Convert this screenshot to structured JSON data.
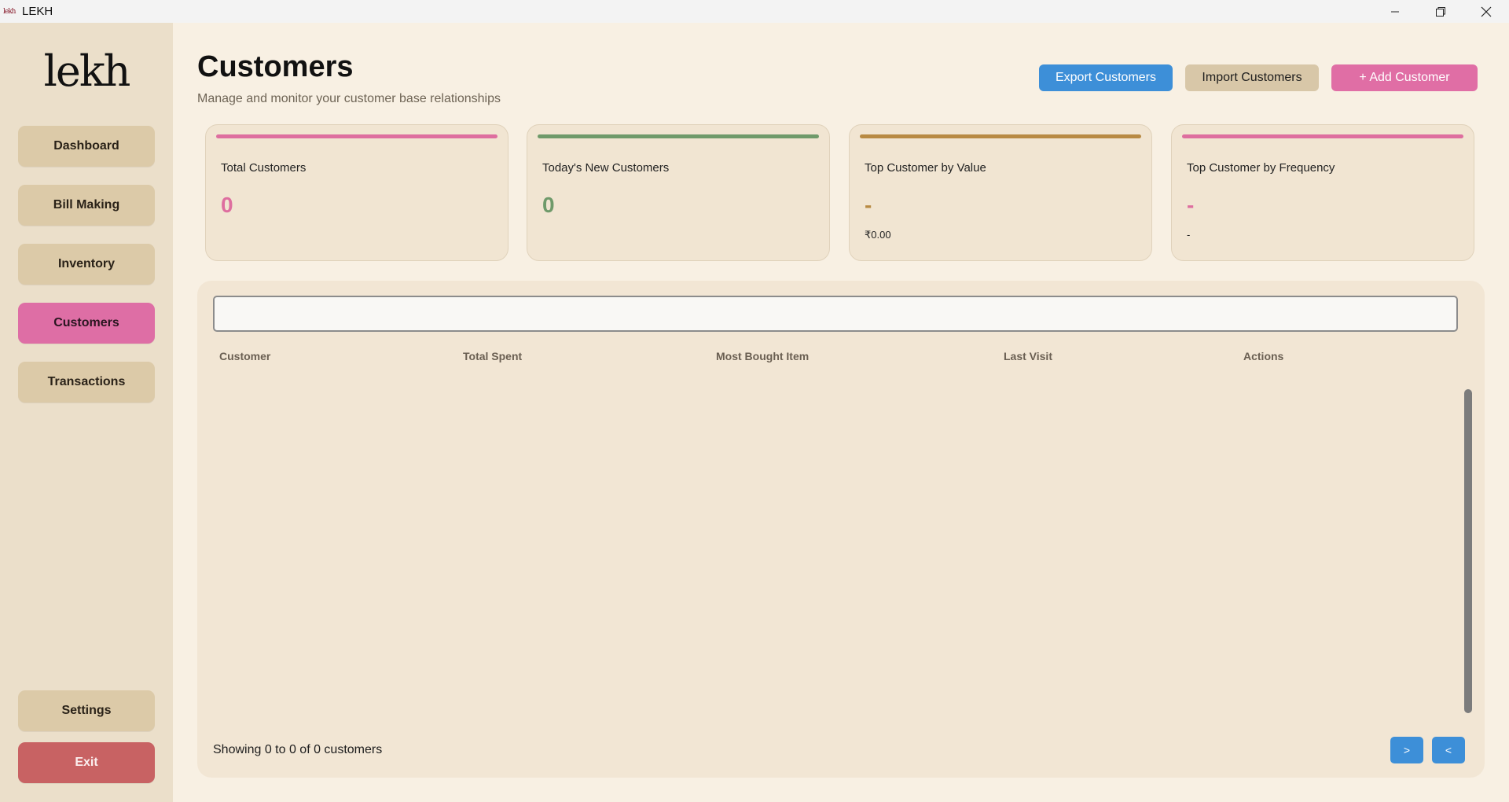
{
  "window": {
    "app_icon_text": "lekh",
    "title": "LEKH"
  },
  "sidebar": {
    "logo": "lekh",
    "items": [
      {
        "label": "Dashboard"
      },
      {
        "label": "Bill Making"
      },
      {
        "label": "Inventory"
      },
      {
        "label": "Customers",
        "active": true
      },
      {
        "label": "Transactions"
      }
    ],
    "settings_label": "Settings",
    "exit_label": "Exit"
  },
  "header": {
    "title": "Customers",
    "subtitle": "Manage and monitor your customer base relationships",
    "export_label": "Export Customers",
    "import_label": "Import Customers",
    "add_label": "+ Add Customer"
  },
  "cards": [
    {
      "label": "Total Customers",
      "value": "0",
      "accent": "#de6e9f"
    },
    {
      "label": "Today's New Customers",
      "value": "0",
      "accent": "#6f9a6a"
    },
    {
      "label": "Top Customer by Value",
      "value": "-",
      "sub": "₹0.00",
      "accent": "#b88a43"
    },
    {
      "label": "Top Customer by Frequency",
      "value": "-",
      "sub": "-",
      "accent": "#de6e9f"
    }
  ],
  "table": {
    "search_value": "",
    "columns": [
      "Customer",
      "Total Spent",
      "Most Bought Item",
      "Last Visit",
      "Actions"
    ],
    "rows": [],
    "footer": "Showing 0 to 0 of 0 customers",
    "next_label": ">",
    "prev_label": "<"
  },
  "colors": {
    "primary_blue": "#3d8fd8",
    "pink": "#e06ea5",
    "exit_red": "#c86263"
  }
}
